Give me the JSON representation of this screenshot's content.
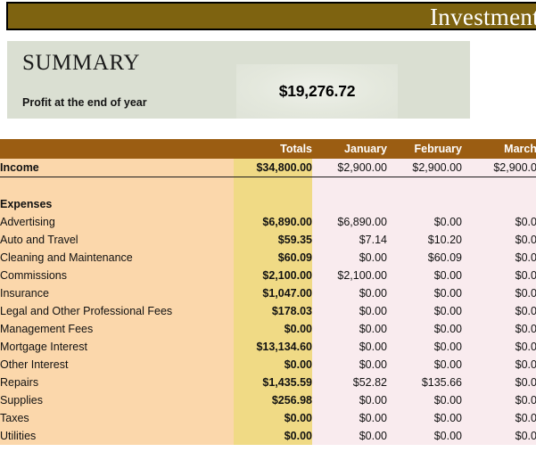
{
  "title_bar": {
    "title": "Investment"
  },
  "summary": {
    "heading": "SUMMARY",
    "subtitle": "Profit at the end of year",
    "profit_value": "$19,276.72"
  },
  "table": {
    "columns": [
      "",
      "Totals",
      "January",
      "February",
      "March"
    ],
    "income": {
      "label": "Income",
      "totals": "$34,800.00",
      "january": "$2,900.00",
      "february": "$2,900.00",
      "march": "$2,900.0"
    },
    "expenses_header": "Expenses",
    "expenses": [
      {
        "label": "Advertising",
        "totals": "$6,890.00",
        "january": "$6,890.00",
        "february": "$0.00",
        "march": "$0.0"
      },
      {
        "label": "Auto and Travel",
        "totals": "$59.35",
        "january": "$7.14",
        "february": "$10.20",
        "march": "$0.0"
      },
      {
        "label": "Cleaning and Maintenance",
        "totals": "$60.09",
        "january": "$0.00",
        "february": "$60.09",
        "march": "$0.0"
      },
      {
        "label": "Commissions",
        "totals": "$2,100.00",
        "january": "$2,100.00",
        "february": "$0.00",
        "march": "$0.0"
      },
      {
        "label": "Insurance",
        "totals": "$1,047.00",
        "january": "$0.00",
        "february": "$0.00",
        "march": "$0.0"
      },
      {
        "label": "Legal and Other Professional Fees",
        "totals": "$178.03",
        "january": "$0.00",
        "february": "$0.00",
        "march": "$0.0"
      },
      {
        "label": "Management Fees",
        "totals": "$0.00",
        "january": "$0.00",
        "february": "$0.00",
        "march": "$0.0"
      },
      {
        "label": "Mortgage Interest",
        "totals": "$13,134.60",
        "january": "$0.00",
        "february": "$0.00",
        "march": "$0.0"
      },
      {
        "label": "Other Interest",
        "totals": "$0.00",
        "january": "$0.00",
        "february": "$0.00",
        "march": "$0.0"
      },
      {
        "label": "Repairs",
        "totals": "$1,435.59",
        "january": "$52.82",
        "february": "$135.66",
        "march": "$0.0"
      },
      {
        "label": "Supplies",
        "totals": "$256.98",
        "january": "$0.00",
        "february": "$0.00",
        "march": "$0.0"
      },
      {
        "label": "Taxes",
        "totals": "$0.00",
        "january": "$0.00",
        "february": "$0.00",
        "march": "$0.0"
      },
      {
        "label": "Utilities",
        "totals": "$0.00",
        "january": "$0.00",
        "february": "$0.00",
        "march": "$0.0"
      }
    ]
  },
  "colors": {
    "banner": "#7e6310",
    "summary_panel": "#dadfd2",
    "table_header": "#9b5d12",
    "label_column": "#fbd7ab",
    "totals_column": "#f0da85",
    "month_column": "#f9ebee"
  }
}
